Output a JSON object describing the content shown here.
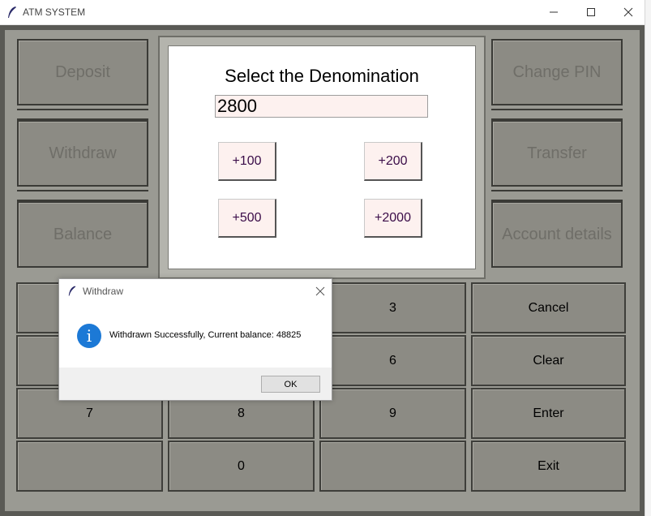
{
  "window": {
    "title": "ATM SYSTEM"
  },
  "side_menu": {
    "left": [
      "Deposit",
      "Withdraw",
      "Balance"
    ],
    "right": [
      "Change PIN",
      "Transfer",
      "Account details"
    ]
  },
  "panel": {
    "title": "Select the Denomination",
    "amount_value": "2800",
    "denominations": [
      "+100",
      "+200",
      "+500",
      "+2000"
    ]
  },
  "keypad": {
    "keys": [
      "",
      "",
      "3",
      "Cancel",
      "",
      "",
      "6",
      "Clear",
      "7",
      "8",
      "9",
      "Enter",
      "",
      "0",
      "",
      "Exit"
    ]
  },
  "dialog": {
    "title": "Withdraw",
    "icon": "info-icon",
    "message": "Withdrawn Successfully, Current balance: 48825",
    "ok_label": "OK"
  },
  "colors": {
    "frame": "#5a5a55",
    "button": "#8c8b84",
    "entry_bg": "#fdf1ef",
    "info_blue": "#1c79d6"
  }
}
